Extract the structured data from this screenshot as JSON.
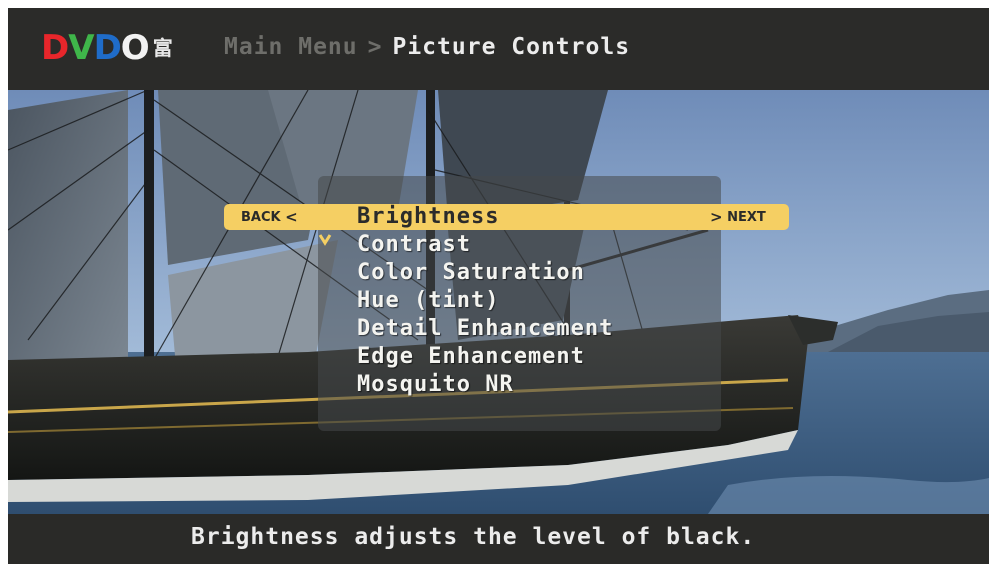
{
  "header": {
    "logo": {
      "letters": [
        "D",
        "V",
        "D",
        "O"
      ],
      "mark": "富",
      "colors": [
        "#e8262b",
        "#3fb64a",
        "#1f6cc9",
        "#f2f2f2"
      ]
    },
    "breadcrumb": {
      "parent": "Main Menu",
      "separator": ">",
      "current": "Picture Controls"
    }
  },
  "menu": {
    "back_label": "BACK",
    "back_arrow": "<",
    "next_label": "NEXT",
    "next_arrow": ">",
    "highlight_color": "#f5cf63",
    "items": [
      {
        "label": "Brightness"
      },
      {
        "label": "Contrast"
      },
      {
        "label": "Color Saturation"
      },
      {
        "label": "Hue (tint)"
      },
      {
        "label": "Detail Enhancement"
      },
      {
        "label": "Edge Enhancement"
      },
      {
        "label": "Mosquito NR"
      }
    ],
    "selected_index": 0,
    "check_icon": "check-mark-icon",
    "check_color": "#f5cf63"
  },
  "footer": {
    "help_text": "Brightness adjusts the level of black."
  }
}
